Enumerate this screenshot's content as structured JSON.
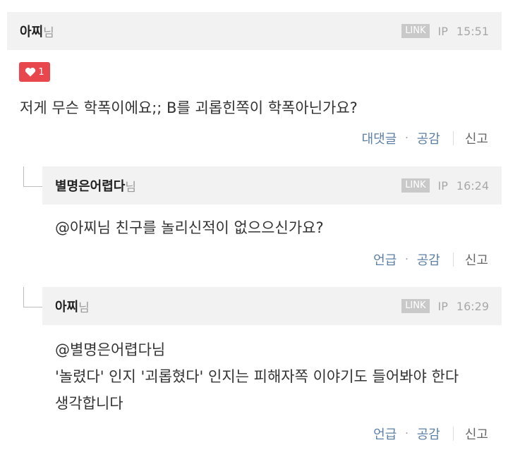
{
  "comments": [
    {
      "nickname": "아찌",
      "suffix": "님",
      "link_label": "LINK",
      "ip_label": "IP",
      "time": "15:51",
      "likes": "1",
      "lines": [
        "저게 무슨 학폭이에요;; B를 괴롭힌쪽이 학폭아닌가요?"
      ],
      "actions": {
        "primary": "대댓글",
        "like": "공감",
        "report": "신고"
      }
    },
    {
      "nickname": "별명은어렵다",
      "suffix": "님",
      "link_label": "LINK",
      "ip_label": "IP",
      "time": "16:24",
      "lines": [
        "@아찌님 친구를 놀리신적이 없으으신가요?"
      ],
      "actions": {
        "primary": "언급",
        "like": "공감",
        "report": "신고"
      }
    },
    {
      "nickname": "아찌",
      "suffix": "님",
      "link_label": "LINK",
      "ip_label": "IP",
      "time": "16:29",
      "lines": [
        "@별명은어렵다님",
        "'놀렸다' 인지 '괴롭혔다' 인지는 피해자쪽 이야기도 들어봐야 한다",
        "생각합니다"
      ],
      "actions": {
        "primary": "언급",
        "like": "공감",
        "report": "신고"
      }
    }
  ],
  "icons": {
    "like": "heart-icon"
  },
  "colors": {
    "like_badge": "#e8474d",
    "action_link": "#5b7fa6",
    "header_bg": "#f2f2f2"
  }
}
